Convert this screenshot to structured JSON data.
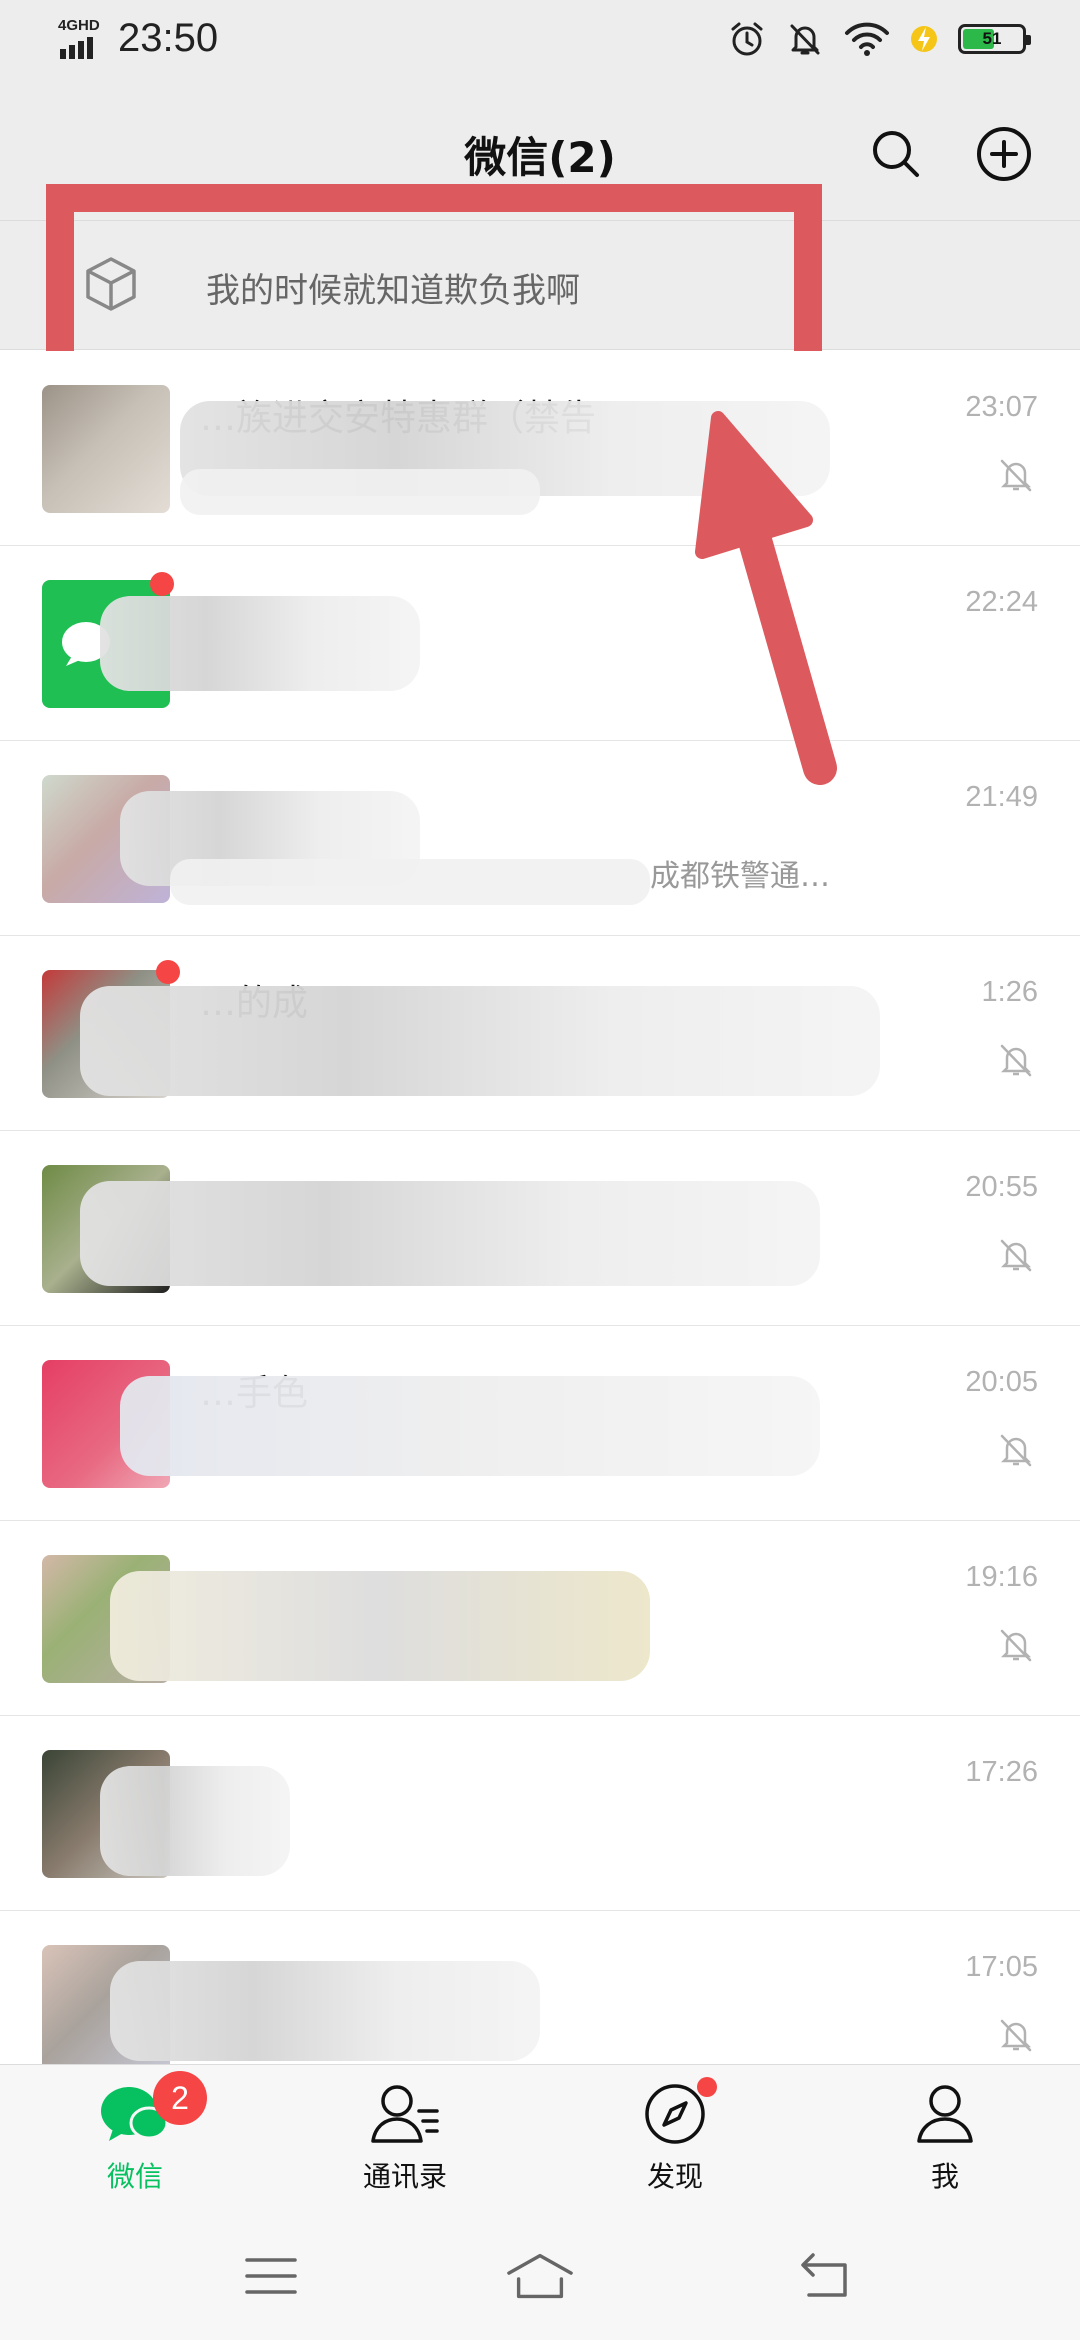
{
  "status_bar": {
    "network": "4GHD",
    "time": "23:50",
    "battery": "51"
  },
  "header": {
    "title": "微信(2)"
  },
  "device_banner": {
    "text": "我的时候就知道欺负我啊"
  },
  "chats": [
    {
      "name": "…族进交安特惠群（禁告",
      "preview": "",
      "time": "23:07",
      "muted": true
    },
    {
      "name": "",
      "preview": "",
      "time": "22:24",
      "muted": false
    },
    {
      "name": "",
      "preview": "成都铁警通…",
      "time": "21:49",
      "muted": false
    },
    {
      "name": "…的成",
      "preview": "",
      "time": "1:26",
      "muted": true
    },
    {
      "name": "",
      "preview": "",
      "time": "20:55",
      "muted": true
    },
    {
      "name": "…手色",
      "preview": "",
      "time": "20:05",
      "muted": true
    },
    {
      "name": "",
      "preview": "",
      "time": "19:16",
      "muted": true
    },
    {
      "name": "",
      "preview": "",
      "time": "17:26",
      "muted": false
    },
    {
      "name": "",
      "preview": "",
      "time": "17:05",
      "muted": true
    }
  ],
  "tabs": [
    {
      "label": "微信",
      "badge": "2"
    },
    {
      "label": "通讯录"
    },
    {
      "label": "发现"
    },
    {
      "label": "我"
    }
  ],
  "colors": {
    "accent": "#07c160",
    "badge": "#f54545",
    "annotation": "#dc5a5e"
  }
}
